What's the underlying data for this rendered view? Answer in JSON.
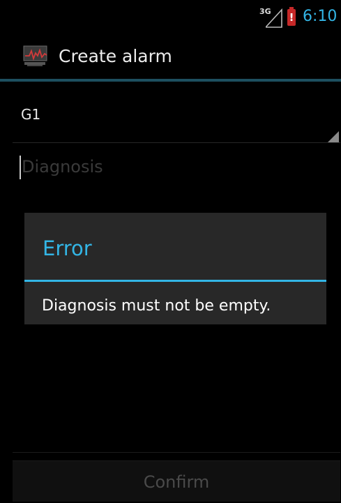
{
  "status_bar": {
    "network": "3G",
    "battery_alert": "!",
    "time": "6:10",
    "battery_color": "#c62828",
    "accent_color": "#33b5e5"
  },
  "action_bar": {
    "icon": "monitor-pulse-icon",
    "title": "Create alarm"
  },
  "form": {
    "spinner_value": "G1",
    "diagnosis_placeholder": "Diagnosis",
    "diagnosis_value": "",
    "confirm_label": "Confirm"
  },
  "dialog": {
    "title": "Error",
    "message": "Diagnosis must not be empty."
  }
}
